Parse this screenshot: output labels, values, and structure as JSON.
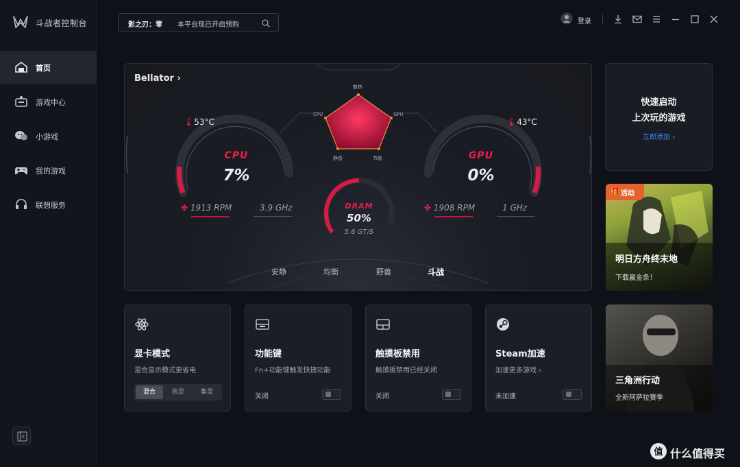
{
  "app": {
    "title": "斗战者控制台"
  },
  "sidebar": {
    "items": [
      {
        "label": "首页",
        "icon": "home-icon",
        "active": true
      },
      {
        "label": "游戏中心",
        "icon": "game-center-icon",
        "active": false
      },
      {
        "label": "小游戏",
        "icon": "mini-game-icon",
        "active": false
      },
      {
        "label": "我的游戏",
        "icon": "gamepad-icon",
        "active": false
      },
      {
        "label": "联想服务",
        "icon": "headset-icon",
        "active": false
      }
    ]
  },
  "search": {
    "tag": "影之刃：零",
    "text": "本平台现已开启预购"
  },
  "header": {
    "login_label": "登录"
  },
  "dashboard": {
    "device_name": "Bellator",
    "cpu": {
      "label": "CPU",
      "usage": "7%",
      "temp": "53°C",
      "fan": "1913 RPM",
      "freq": "3.9 GHz",
      "usage_value": 7
    },
    "gpu": {
      "label": "GPU",
      "usage": "0%",
      "temp": "43°C",
      "fan": "1908 RPM",
      "freq": "1 GHz",
      "usage_value": 0
    },
    "dram": {
      "label": "DRAM",
      "usage": "50%",
      "speed": "5.6 GT/S",
      "usage_value": 50
    },
    "radar": {
      "labels": {
        "top": "散热",
        "left": "CPU",
        "right": "GPU",
        "bottom_left": "静音",
        "bottom_right": "节能"
      }
    },
    "modes": [
      {
        "label": "安静",
        "active": false
      },
      {
        "label": "均衡",
        "active": false
      },
      {
        "label": "野兽",
        "active": false
      },
      {
        "label": "斗战",
        "active": true
      }
    ]
  },
  "quick_launch": {
    "line1": "快速启动",
    "line2": "上次玩的游戏",
    "link": "立即添加 ›"
  },
  "promos": [
    {
      "badge": "活动",
      "title": "明日方舟终末地",
      "subtitle": "下载赢金条！"
    },
    {
      "title": "三角洲行动",
      "subtitle": "全新阿萨拉赛季"
    }
  ],
  "features": {
    "gpu_mode": {
      "title": "显卡模式",
      "desc": "混合显示模式更省电",
      "options": [
        "混合",
        "独显",
        "集显"
      ],
      "selected": "混合"
    },
    "fn_key": {
      "title": "功能键",
      "desc": "Fn+功能键触发快捷功能",
      "state": "关闭"
    },
    "touchpad": {
      "title": "触摸板禁用",
      "desc": "触摸板禁用已经关闭",
      "state": "关闭"
    },
    "steam": {
      "title": "Steam加速",
      "desc": "加速更多游戏 ›",
      "state": "未加速"
    }
  },
  "watermark": {
    "text": "什么值得买"
  },
  "colors": {
    "accent": "#e8204a",
    "link": "#3d8bff",
    "badge": "#e2632c",
    "bg": "#0f1118"
  }
}
